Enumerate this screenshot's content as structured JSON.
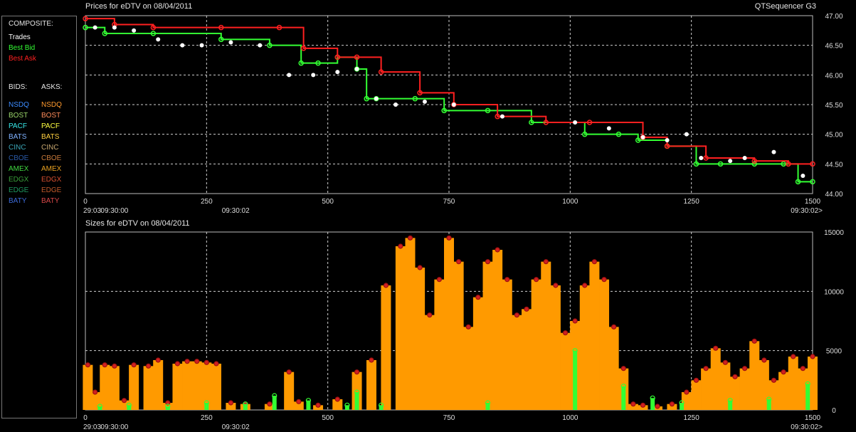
{
  "window": {
    "app_name": "QTSequencer G3"
  },
  "legend": {
    "composite_title": "COMPOSITE:",
    "composite": [
      {
        "label": "Trades",
        "color": "#ffffff"
      },
      {
        "label": "Best Bid",
        "color": "#33ff33"
      },
      {
        "label": "Best Ask",
        "color": "#ff2020"
      }
    ],
    "bids_title": "BIDS:",
    "asks_title": "ASKS:",
    "exchanges": [
      {
        "bid": "NSDQ",
        "ask": "NSDQ",
        "bid_color": "#3c8cff",
        "ask_color": "#ff9a2e"
      },
      {
        "bid": "BOST",
        "ask": "BOST",
        "bid_color": "#9ad46a",
        "ask_color": "#ff8c5a"
      },
      {
        "bid": "PACF",
        "ask": "PACF",
        "bid_color": "#37e8e8",
        "ask_color": "#ffff40"
      },
      {
        "bid": "BATS",
        "ask": "BATS",
        "bid_color": "#7fb2ff",
        "ask_color": "#ffd040"
      },
      {
        "bid": "CINC",
        "ask": "CINC",
        "bid_color": "#3aa6b8",
        "ask_color": "#c8a870"
      },
      {
        "bid": "CBOE",
        "ask": "CBOE",
        "bid_color": "#2a5aa8",
        "ask_color": "#c87a3a"
      },
      {
        "bid": "AMEX",
        "ask": "AMEX",
        "bid_color": "#40d840",
        "ask_color": "#e8a020"
      },
      {
        "bid": "EDGX",
        "ask": "EDGX",
        "bid_color": "#3aa03a",
        "ask_color": "#d85030"
      },
      {
        "bid": "EDGE",
        "ask": "EDGE",
        "bid_color": "#1f9a60",
        "ask_color": "#c05a2a"
      },
      {
        "bid": "BATY",
        "ask": "BATY",
        "bid_color": "#3c6ad8",
        "ask_color": "#d84848"
      }
    ]
  },
  "chart_data": [
    {
      "type": "line",
      "title": "Prices for eDTV on 08/04/2011",
      "xlim": [
        0,
        1500
      ],
      "ylim": [
        44.0,
        47.0
      ],
      "x_ticks": [
        "0",
        "250",
        "500",
        "750",
        "1000",
        "1250",
        "1500"
      ],
      "y_ticks": [
        "44.00",
        "44.50",
        "45.00",
        "45.50",
        "46.00",
        "46.50",
        "47.00"
      ],
      "time_labels": [
        {
          "x": 0,
          "text": "29:03"
        },
        {
          "x": 60,
          "text": "09:30:00"
        },
        {
          "x": 310,
          "text": "09:30:02"
        },
        {
          "x": 1500,
          "text": "09:30:02>"
        }
      ],
      "grid": true,
      "series": [
        {
          "name": "Best Bid",
          "color": "#33ff33",
          "x": [
            0,
            40,
            140,
            280,
            380,
            445,
            480,
            520,
            560,
            580,
            600,
            680,
            740,
            830,
            920,
            1030,
            1100,
            1140,
            1200,
            1260,
            1310,
            1380,
            1440,
            1470,
            1500
          ],
          "y": [
            46.8,
            46.7,
            46.7,
            46.6,
            46.5,
            46.2,
            46.2,
            46.3,
            46.1,
            45.6,
            45.6,
            45.6,
            45.4,
            45.4,
            45.2,
            45.0,
            45.0,
            44.9,
            44.8,
            44.5,
            44.5,
            44.5,
            44.5,
            44.2,
            44.2
          ]
        },
        {
          "name": "Best Ask",
          "color": "#ff2020",
          "x": [
            0,
            60,
            140,
            280,
            400,
            450,
            520,
            560,
            610,
            690,
            760,
            850,
            950,
            1040,
            1150,
            1200,
            1280,
            1380,
            1450,
            1500
          ],
          "y": [
            46.95,
            46.85,
            46.8,
            46.8,
            46.8,
            46.45,
            46.3,
            46.3,
            46.05,
            45.7,
            45.5,
            45.3,
            45.2,
            45.2,
            44.95,
            44.8,
            44.6,
            44.55,
            44.5,
            44.5
          ]
        },
        {
          "name": "Trades",
          "color": "#ffffff",
          "x": [
            20,
            60,
            100,
            150,
            200,
            240,
            300,
            360,
            420,
            470,
            520,
            560,
            600,
            640,
            700,
            760,
            860,
            1010,
            1080,
            1150,
            1200,
            1240,
            1270,
            1330,
            1360,
            1420,
            1480
          ],
          "y": [
            46.8,
            46.8,
            46.75,
            46.6,
            46.5,
            46.5,
            46.55,
            46.5,
            46.0,
            46.0,
            46.05,
            46.1,
            45.6,
            45.5,
            45.55,
            45.5,
            45.3,
            45.2,
            45.1,
            44.95,
            44.9,
            45.0,
            44.6,
            44.55,
            44.6,
            44.7,
            44.3
          ]
        }
      ]
    },
    {
      "type": "bar",
      "title": "Sizes for eDTV on 08/04/2011",
      "xlim": [
        0,
        1500
      ],
      "ylim": [
        0,
        15000
      ],
      "x_ticks": [
        "0",
        "250",
        "500",
        "750",
        "1000",
        "1250",
        "1500"
      ],
      "y_ticks": [
        "0",
        "5000",
        "10000",
        "15000"
      ],
      "time_labels": [
        {
          "x": 0,
          "text": "29:03"
        },
        {
          "x": 60,
          "text": "09:30:00"
        },
        {
          "x": 310,
          "text": "09:30:02"
        },
        {
          "x": 1500,
          "text": "09:30:02>"
        }
      ],
      "grid": true,
      "series": [
        {
          "name": "Best Ask",
          "color": "#ff9a00",
          "x": [
            5,
            20,
            40,
            60,
            80,
            100,
            130,
            150,
            170,
            190,
            210,
            230,
            250,
            270,
            300,
            330,
            380,
            420,
            440,
            480,
            520,
            560,
            590,
            620,
            650,
            670,
            690,
            710,
            730,
            750,
            770,
            790,
            810,
            830,
            850,
            870,
            890,
            910,
            930,
            950,
            970,
            990,
            1010,
            1030,
            1050,
            1070,
            1090,
            1110,
            1130,
            1150,
            1180,
            1210,
            1240,
            1260,
            1280,
            1300,
            1320,
            1340,
            1360,
            1380,
            1400,
            1420,
            1440,
            1460,
            1480,
            1500
          ],
          "y": [
            3800,
            1500,
            3800,
            3700,
            800,
            3800,
            3700,
            4200,
            600,
            3900,
            4100,
            4100,
            4000,
            3900,
            600,
            500,
            500,
            3200,
            700,
            400,
            900,
            3200,
            4200,
            10500,
            13800,
            14500,
            12000,
            8000,
            11000,
            14500,
            12500,
            7000,
            9500,
            12500,
            13500,
            11000,
            8000,
            8500,
            11000,
            12500,
            10500,
            6500,
            7500,
            10500,
            12500,
            11000,
            7000,
            3500,
            500,
            400,
            300,
            500,
            1500,
            2500,
            3500,
            5200,
            4000,
            2800,
            3500,
            5800,
            4200,
            2500,
            3200,
            4500,
            3500,
            4500
          ]
        },
        {
          "name": "Best Bid",
          "color": "#33ff33",
          "x": [
            30,
            90,
            170,
            250,
            330,
            390,
            460,
            540,
            560,
            610,
            830,
            1010,
            1110,
            1170,
            1230,
            1330,
            1410,
            1490
          ],
          "y": [
            300,
            400,
            300,
            600,
            500,
            1200,
            800,
            400,
            1500,
            400,
            600,
            5000,
            2000,
            1000,
            600,
            800,
            900,
            2200
          ]
        }
      ]
    }
  ]
}
